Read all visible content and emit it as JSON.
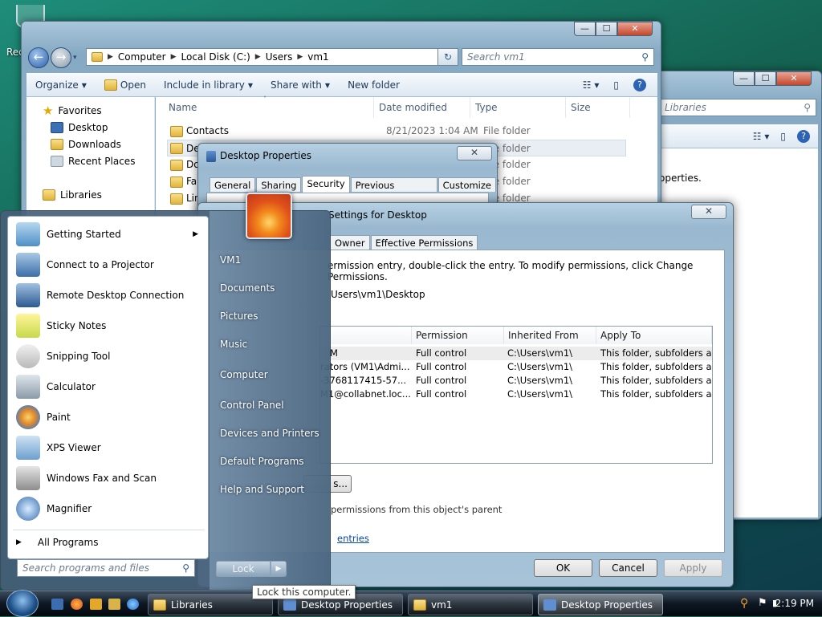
{
  "desktop": {
    "recycle_label": "Rec"
  },
  "explorer": {
    "address": [
      "Computer",
      "Local Disk (C:)",
      "Users",
      "vm1"
    ],
    "search_placeholder": "Search vm1",
    "toolbar": [
      "Organize",
      "Open",
      "Include in library",
      "Share with",
      "New folder"
    ],
    "nav": {
      "favorites": "Favorites",
      "items": [
        "Desktop",
        "Downloads",
        "Recent Places"
      ],
      "libraries": "Libraries"
    },
    "columns": [
      "Name",
      "Date modified",
      "Type",
      "Size"
    ],
    "rows": [
      {
        "name": "Contacts",
        "date": "8/21/2023 1:04 AM",
        "type": "File folder"
      },
      {
        "name": "Desktop",
        "date": "",
        "type": "File folder"
      },
      {
        "name": "Do",
        "date": "",
        "type": "File folder"
      },
      {
        "name": "Fa",
        "date": "",
        "type": "File folder"
      },
      {
        "name": "Lin",
        "date": "",
        "type": "File folder"
      }
    ]
  },
  "explorer2": {
    "search_placeholder": "Libraries",
    "text": "operties."
  },
  "props": {
    "title": "Desktop Properties",
    "tabs": [
      "General",
      "Sharing",
      "Security",
      "Previous Versions",
      "Customize"
    ]
  },
  "adv": {
    "title": "Settings for Desktop",
    "tabs": [
      "Owner",
      "Effective Permissions"
    ],
    "info": "ermission entry, double-click the entry. To modify permissions, click Change Permissions.",
    "object_name": "Users\\vm1\\Desktop",
    "columns": [
      "Permission",
      "Inherited From",
      "Apply To"
    ],
    "rows": [
      {
        "principal": "M",
        "perm": "Full control",
        "inherited": "C:\\Users\\vm1\\",
        "apply": "This folder, subfolders and..."
      },
      {
        "principal": "rators (VM1\\Admi...",
        "perm": "Full control",
        "inherited": "C:\\Users\\vm1\\",
        "apply": "This folder, subfolders and..."
      },
      {
        "principal": "-3768117415-57...",
        "perm": "Full control",
        "inherited": "C:\\Users\\vm1\\",
        "apply": "This folder, subfolders and..."
      },
      {
        "principal": "M1@collabnet.loc...",
        "perm": "Full control",
        "inherited": "C:\\Users\\vm1\\",
        "apply": "This folder, subfolders and..."
      }
    ],
    "change_btn": "s...",
    "inherit_text": "permissions from this object's parent",
    "link": "entries",
    "ok": "OK",
    "cancel": "Cancel",
    "apply": "Apply"
  },
  "startmenu": {
    "programs": [
      "Getting Started",
      "Connect to a Projector",
      "Remote Desktop Connection",
      "Sticky Notes",
      "Snipping Tool",
      "Calculator",
      "Paint",
      "XPS Viewer",
      "Windows Fax and Scan",
      "Magnifier"
    ],
    "all_programs": "All Programs",
    "search_placeholder": "Search programs and files",
    "right": [
      "VM1",
      "Documents",
      "Pictures",
      "Music",
      "Computer",
      "Control Panel",
      "Devices and Printers",
      "Default Programs",
      "Help and Support"
    ],
    "lock": "Lock",
    "tooltip": "Lock this computer."
  },
  "taskbar": {
    "tasks": [
      "Libraries",
      "Desktop Properties",
      "vm1",
      "Desktop Properties"
    ],
    "time": "2:19 PM"
  }
}
